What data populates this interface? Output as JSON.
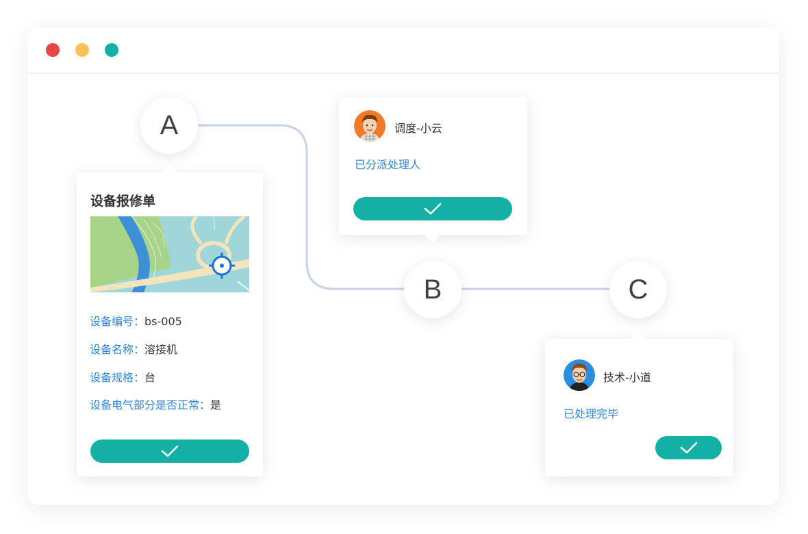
{
  "window": {
    "controls": [
      "close",
      "minimize",
      "maximize"
    ],
    "colors": {
      "close": "#e84545",
      "minimize": "#fcc05a",
      "maximize": "#12b0a5"
    }
  },
  "nodes": {
    "a": "A",
    "b": "B",
    "c": "C"
  },
  "repair_form": {
    "title": "设备报修单",
    "map_icon": "location-target-icon",
    "fields": [
      {
        "label": "设备编号：",
        "value": "bs-005"
      },
      {
        "label": "设备名称：",
        "value": "溶接机"
      },
      {
        "label": "设备规格：",
        "value": "台"
      },
      {
        "label": "设备电气部分是否正常：",
        "value": "是"
      }
    ],
    "confirm_icon": "checkmark-icon"
  },
  "dispatch_card": {
    "person": "调度-小云",
    "status": "已分派处理人",
    "confirm_icon": "checkmark-icon"
  },
  "tech_card": {
    "person": "技术-小道",
    "status": "已处理完毕",
    "confirm_icon": "checkmark-icon"
  },
  "colors": {
    "accent": "#12b0a5",
    "link_blue": "#2f86d8",
    "connector": "#c8d2e6"
  }
}
